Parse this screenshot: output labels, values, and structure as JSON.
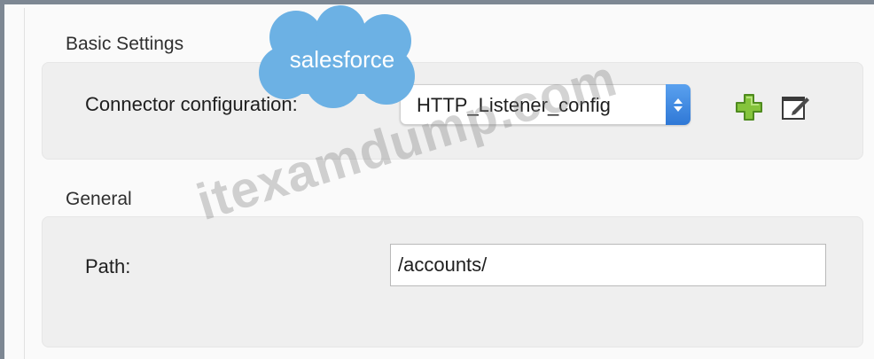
{
  "basic_settings": {
    "title": "Basic Settings",
    "connector_label": "Connector configuration:",
    "connector_value": "HTTP_Listener_config",
    "add_icon": "plus-icon",
    "edit_icon": "edit-icon"
  },
  "general": {
    "title": "General",
    "path_label": "Path:",
    "path_value": "/accounts/"
  },
  "overlay": {
    "logo_text": "salesforce",
    "watermark": "itexamdump.com"
  },
  "colors": {
    "frame": "#7d8793",
    "panel": "#efefef",
    "stepper": "#2f78d6",
    "logo_cloud": "#6cb1e4",
    "plus_icon": "#7fbd37"
  }
}
